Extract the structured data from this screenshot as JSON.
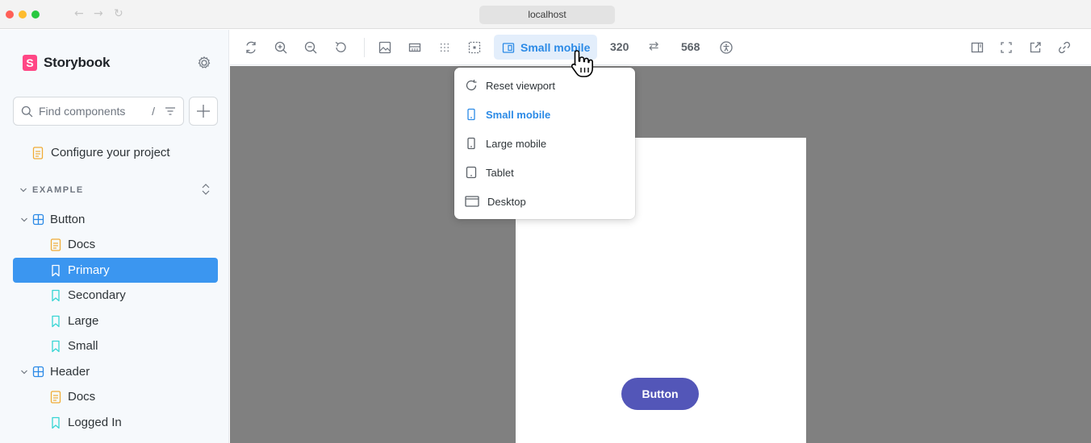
{
  "browser": {
    "url": "localhost"
  },
  "sidebar": {
    "brand_name": "Storybook",
    "brand_logo_letter": "S",
    "search_placeholder": "Find components",
    "search_shortcut": "/",
    "configure_label": "Configure your project",
    "section_label": "EXAMPLE",
    "items": [
      {
        "label": "Button",
        "kind": "component"
      },
      {
        "label": "Docs",
        "kind": "docs"
      },
      {
        "label": "Primary",
        "kind": "story",
        "selected": true
      },
      {
        "label": "Secondary",
        "kind": "story"
      },
      {
        "label": "Large",
        "kind": "story"
      },
      {
        "label": "Small",
        "kind": "story"
      },
      {
        "label": "Header",
        "kind": "component"
      },
      {
        "label": "Docs",
        "kind": "docs"
      },
      {
        "label": "Logged In",
        "kind": "story"
      }
    ]
  },
  "toolbar": {
    "viewport_label": "Small mobile",
    "width": "320",
    "height": "568",
    "swap_icon": "⇄"
  },
  "viewport_menu": {
    "items": [
      {
        "label": "Reset viewport",
        "icon": "reset-icon"
      },
      {
        "label": "Small mobile",
        "icon": "mobile-icon",
        "active": true
      },
      {
        "label": "Large mobile",
        "icon": "mobile-icon"
      },
      {
        "label": "Tablet",
        "icon": "tablet-icon"
      },
      {
        "label": "Desktop",
        "icon": "desktop-icon"
      }
    ]
  },
  "preview": {
    "button_label": "Button"
  },
  "colors": {
    "accent": "#3b96f0",
    "storybook_pink": "#ff4785",
    "story_button": "#5356b8",
    "canvas_bg": "#808080"
  }
}
